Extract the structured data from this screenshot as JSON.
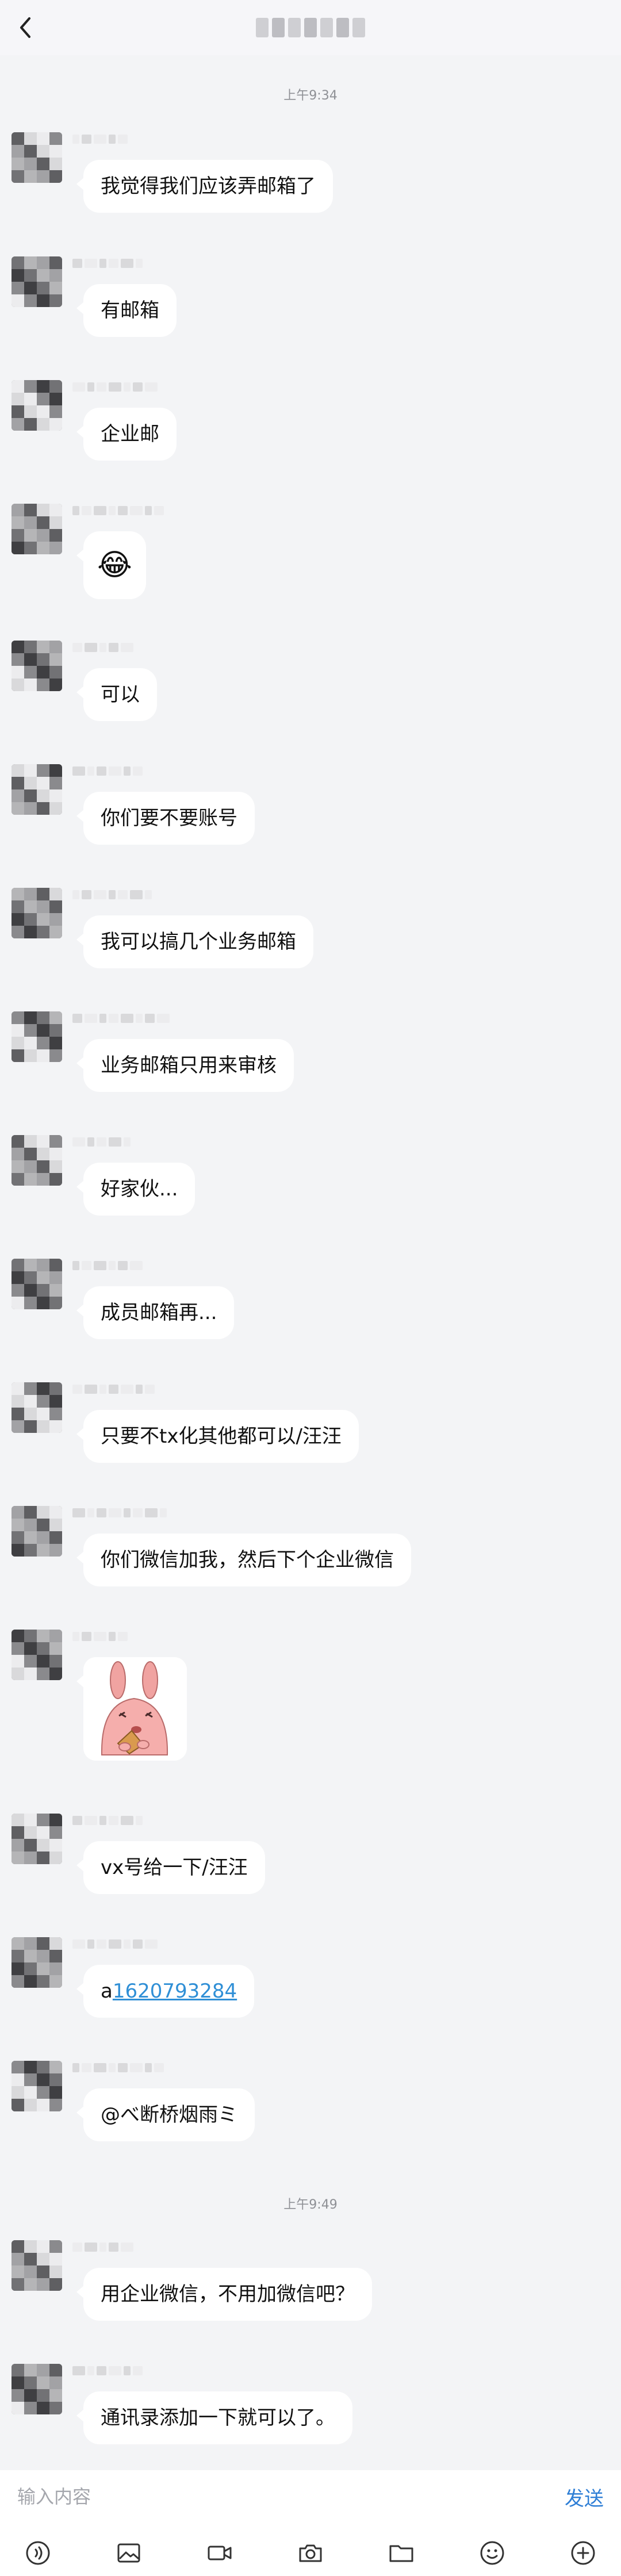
{
  "header": {
    "back_icon": "chevron-left-icon"
  },
  "messages": [
    {
      "time": "上午9:34"
    },
    {
      "text": "我觉得我们应该弄邮箱了"
    },
    {
      "text": "有邮箱"
    },
    {
      "text": "企业邮"
    },
    {
      "emoji": "😂"
    },
    {
      "text": "可以"
    },
    {
      "text": "你们要不要账号"
    },
    {
      "text": "我可以搞几个业务邮箱"
    },
    {
      "text": "业务邮箱只用来审核"
    },
    {
      "text": "好家伙..."
    },
    {
      "text": "成员邮箱再..."
    },
    {
      "text": "只要不tx化其他都可以/汪汪"
    },
    {
      "text": "你们微信加我，然后下个企业微信"
    },
    {
      "sticker": "pink-rabbit-eating-sticker"
    },
    {
      "text": "vx号给一下/汪汪"
    },
    {
      "prefix": "a",
      "link": "1620793284"
    },
    {
      "text": "@べ断桥烟雨ミ"
    },
    {
      "time": "上午9:49"
    },
    {
      "text": "用企业微信，不用加微信吧？"
    },
    {
      "text": "通讯录添加一下就可以了。"
    }
  ],
  "input": {
    "placeholder": "输入内容",
    "send_label": "发送"
  },
  "toolbar": {
    "icons": [
      "voice-icon",
      "image-icon",
      "video-icon",
      "camera-icon",
      "folder-icon",
      "emoji-icon",
      "plus-icon"
    ]
  },
  "colors": {
    "accent": "#2f7fd6",
    "bubble": "#ffffff",
    "background": "#f3f4f6"
  }
}
